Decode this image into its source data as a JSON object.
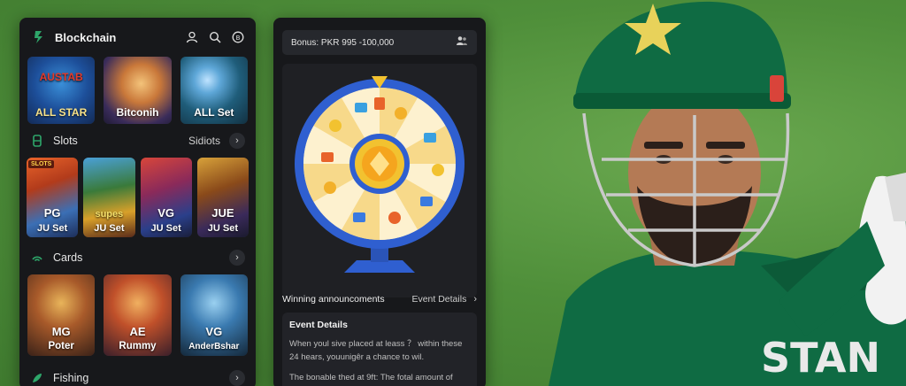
{
  "colors": {
    "panel_bg": "#17181b",
    "accent_green": "#2ea66a",
    "wheel_blue": "#2f5fd0",
    "wheel_gold": "#f2c230",
    "field_green": "#4f8f3a"
  },
  "icons": {
    "logo": "brand-logo-icon",
    "profile": "user-icon",
    "search": "search-icon",
    "coin": "coin-icon",
    "bonus": "gift-users-icon"
  },
  "left_panel": {
    "header": {
      "title": "Blockchain"
    },
    "blockchain_games": [
      {
        "title": "ALL STAR",
        "art_text": "AUSTAB"
      },
      {
        "title": "Bitconih"
      },
      {
        "title": "ALL Set"
      }
    ],
    "slots": {
      "label": "Slots",
      "link": "Sidiots",
      "games": [
        {
          "name": "PG",
          "provider": "JU Set",
          "badge": "SLOTS"
        },
        {
          "name": "supes",
          "provider": "JU Set"
        },
        {
          "name": "VG",
          "provider": "JU Set"
        },
        {
          "name": "JUE",
          "provider": "JU Set"
        }
      ]
    },
    "cards": {
      "label": "Cards",
      "games": [
        {
          "name": "MG",
          "title": "Poter"
        },
        {
          "name": "AE",
          "title": "Rummy"
        },
        {
          "name": "VG",
          "title": "AnderBshar"
        }
      ]
    },
    "fishing": {
      "label": "Fishing"
    }
  },
  "mid_panel": {
    "bonus": "Bonus: PKR 995 -100,000",
    "winning_label": "Winning announcoments",
    "event_link": "Event Details",
    "event": {
      "title": "Event Details",
      "p1": "When youl sive placed at leass ？ within these 24 hears, youunigêr a chance to wil.",
      "p2": "The bonable thed at 9ft: The fotal amount of"
    }
  },
  "photo": {
    "jersey_text": "STAN"
  }
}
